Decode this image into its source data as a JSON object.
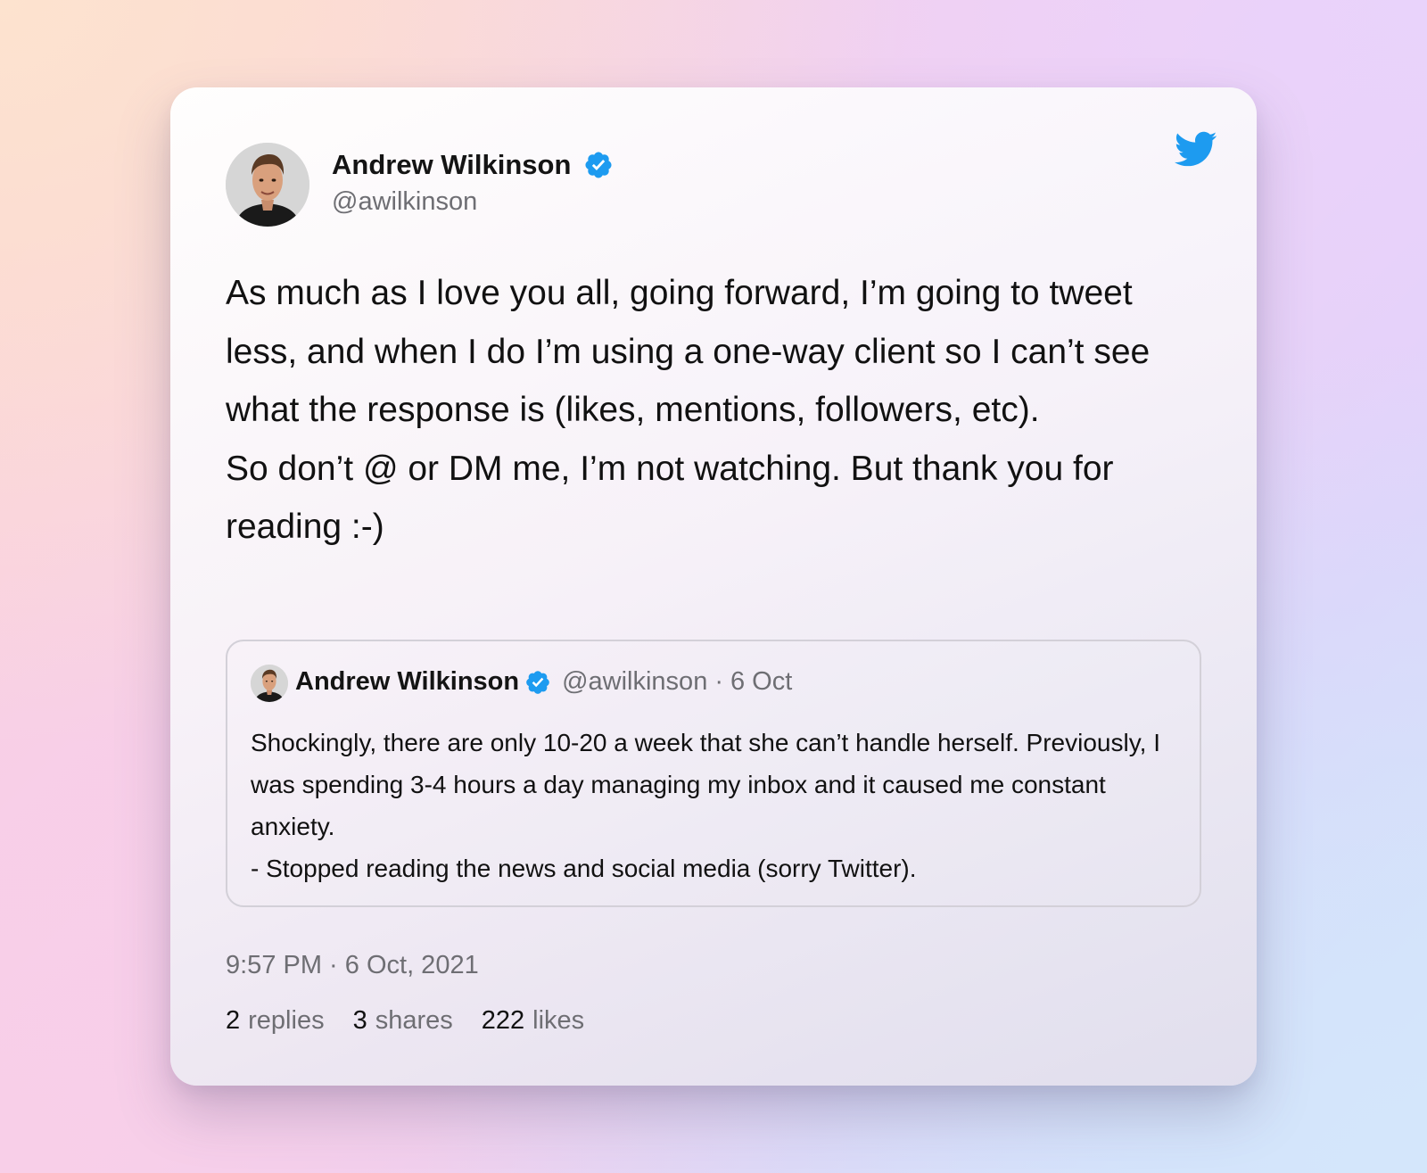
{
  "tweet": {
    "author": {
      "name": "Andrew Wilkinson",
      "handle": "@awilkinson",
      "verified": true
    },
    "text_paragraphs": [
      "As much as I love you all, going forward, I’m going to tweet less, and when I do I’m using a one-way client so I can’t see what the response is (likes, mentions, followers, etc).",
      "So don’t @ or DM me, I’m not watching. But thank you for reading :-)"
    ],
    "quoted_tweet": {
      "author_name": "Andrew Wilkinson",
      "handle": "@awilkinson",
      "separator": "·",
      "date": "6 Oct",
      "text_lines": [
        "Shockingly, there are only 10-20 a week that she can’t handle herself. Previously, I was spending 3-4 hours a day managing my inbox and it caused me constant anxiety.",
        "- Stopped reading the news and social media (sorry Twitter)."
      ]
    },
    "timestamp": "9:57 PM · 6 Oct, 2021",
    "stats": {
      "replies": {
        "count": "2",
        "label": "replies"
      },
      "shares": {
        "count": "3",
        "label": "shares"
      },
      "likes": {
        "count": "222",
        "label": "likes"
      }
    }
  },
  "icons": {
    "logo": "twitter-bird-icon",
    "verified": "verified-badge-icon"
  },
  "colors": {
    "twitter_blue": "#1d9bf0",
    "text_primary": "#111111",
    "text_secondary": "#6e6e73"
  }
}
